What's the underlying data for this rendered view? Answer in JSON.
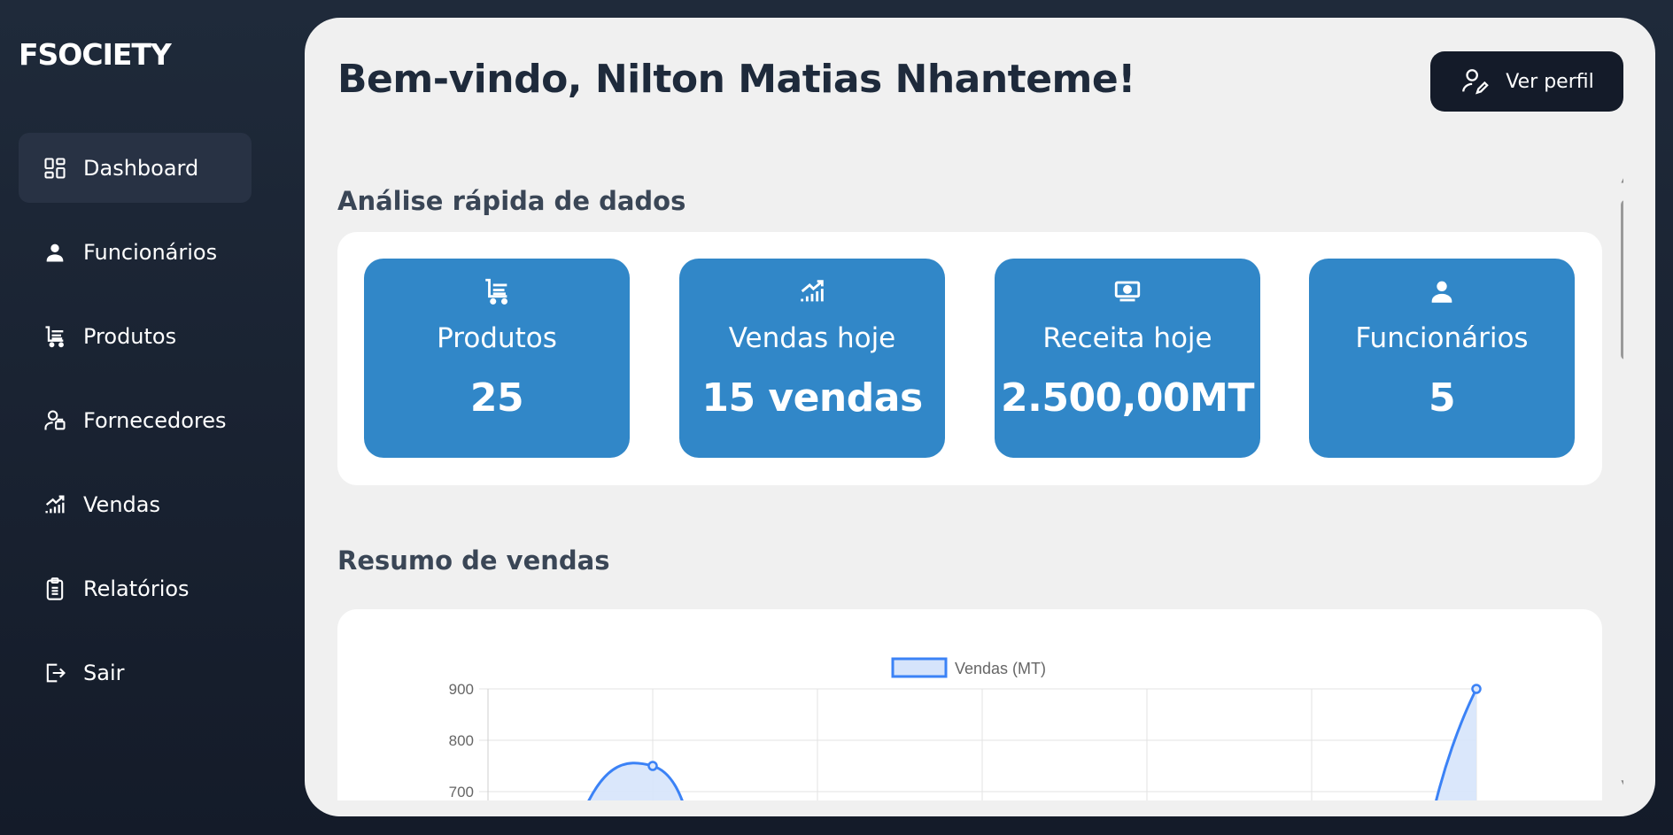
{
  "sidebar": {
    "brand": "FSOCIETY",
    "items": [
      {
        "label": "Dashboard",
        "icon": "dashboard-icon",
        "active": true
      },
      {
        "label": "Funcionários",
        "icon": "user-icon",
        "active": false
      },
      {
        "label": "Produtos",
        "icon": "cart-icon",
        "active": false
      },
      {
        "label": "Fornecedores",
        "icon": "supplier-icon",
        "active": false
      },
      {
        "label": "Vendas",
        "icon": "chart-growth-icon",
        "active": false
      },
      {
        "label": "Relatórios",
        "icon": "clipboard-icon",
        "active": false
      },
      {
        "label": "Sair",
        "icon": "logout-icon",
        "active": false
      }
    ]
  },
  "header": {
    "welcome": "Bem-vindo, Nilton Matias Nhanteme!",
    "profile_button": "Ver perfil"
  },
  "quick_analysis": {
    "title": "Análise rápida de dados",
    "cards": [
      {
        "label": "Produtos",
        "value": "25",
        "icon": "cart-icon"
      },
      {
        "label": "Vendas hoje",
        "value": "15 vendas",
        "icon": "chart-growth-icon"
      },
      {
        "label": "Receita hoje",
        "value": "2.500,00MT",
        "icon": "money-icon"
      },
      {
        "label": "Funcionários",
        "value": "5",
        "icon": "user-icon"
      }
    ]
  },
  "sales_summary": {
    "title": "Resumo de vendas"
  },
  "colors": {
    "sidebar_bg": "#1a2232",
    "accent": "#3187c8",
    "line": "#3b82f6",
    "line_fill": "#d6e4fb"
  },
  "chart_data": {
    "type": "line",
    "series": [
      {
        "name": "Vendas (MT)",
        "points": [
          {
            "x": 1,
            "y": 750
          },
          {
            "x": 6,
            "y": 900
          }
        ]
      }
    ],
    "y_ticks": [
      700,
      800,
      900
    ],
    "ylim_visible": [
      680,
      910
    ],
    "x_count": 7,
    "grid": true,
    "legend": "top-center"
  }
}
